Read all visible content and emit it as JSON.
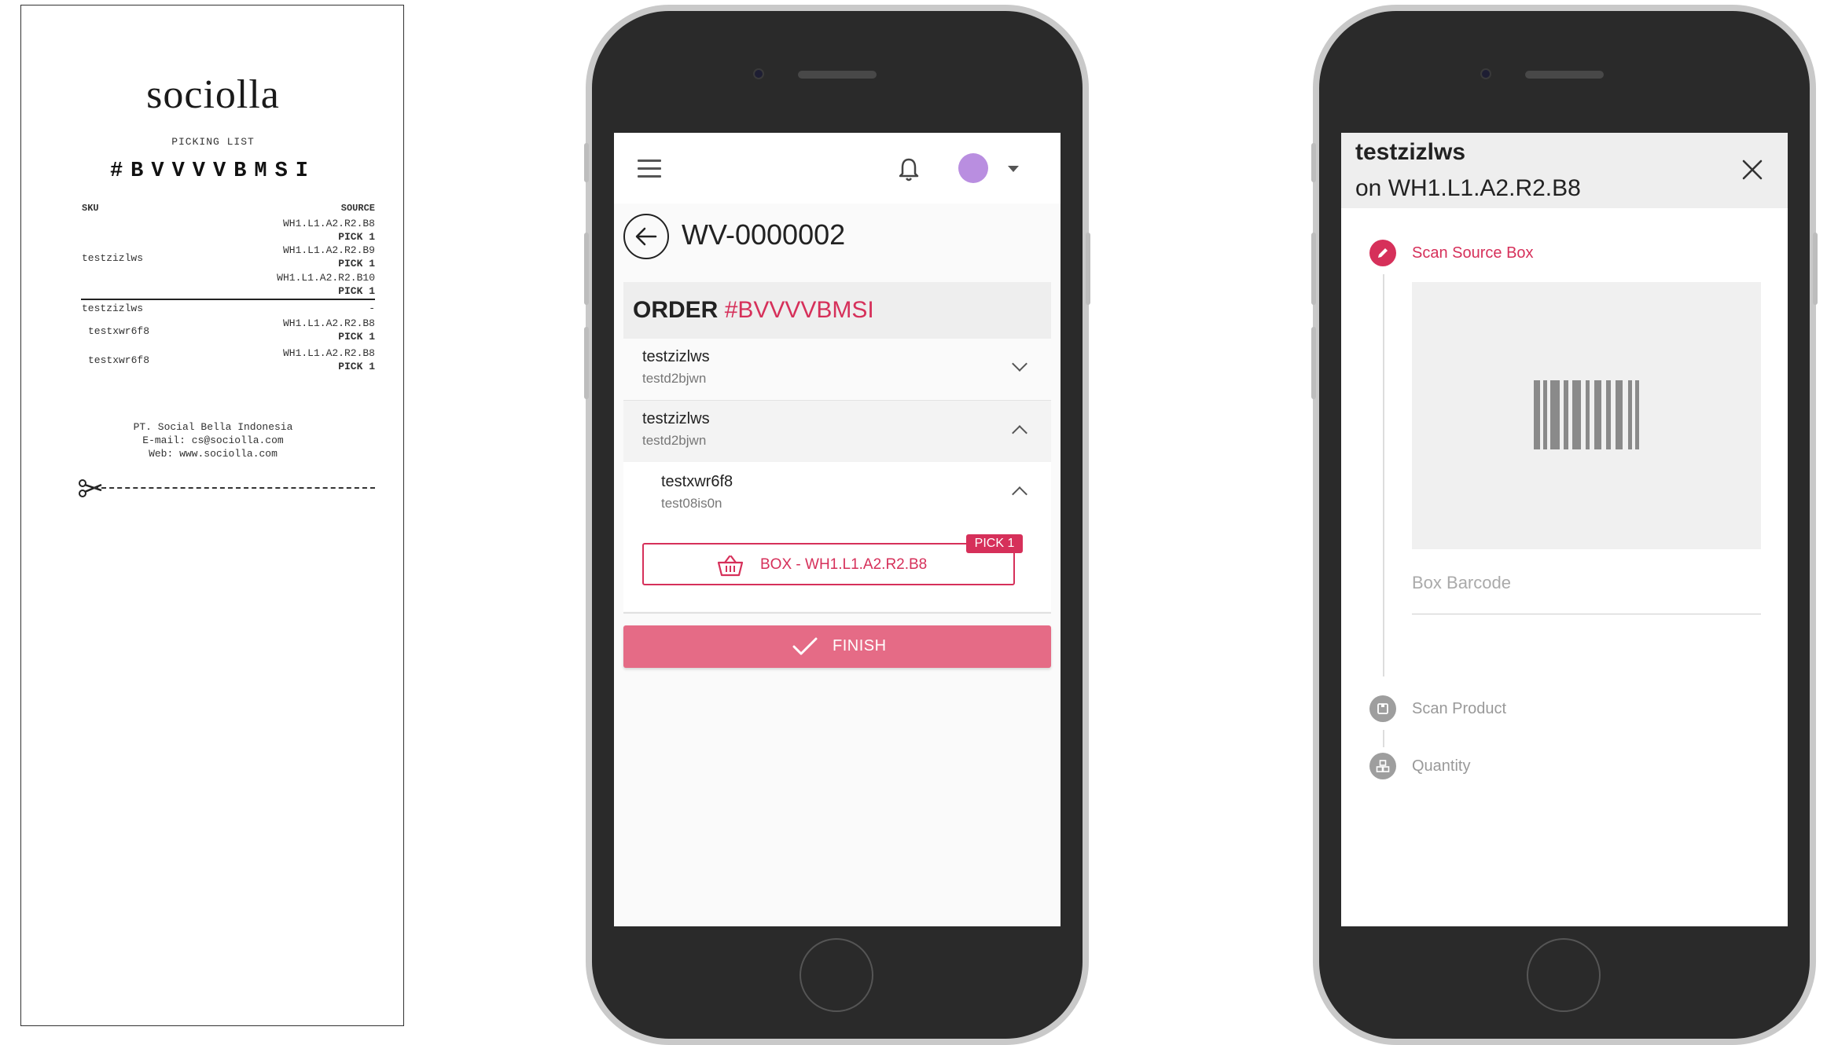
{
  "receipt": {
    "brand": "sociolla",
    "subtitle": "PICKING LIST",
    "order_number": "#BVVVVBMSI",
    "columns": {
      "sku": "SKU",
      "source": "SOURCE"
    },
    "group1": {
      "sku": "testzizlws",
      "sources": [
        {
          "location": "WH1.L1.A2.R2.B8",
          "pick": "PICK 1"
        },
        {
          "location": "WH1.L1.A2.R2.B9",
          "pick": "PICK 1"
        },
        {
          "location": "WH1.L1.A2.R2.B10",
          "pick": "PICK 1"
        }
      ]
    },
    "group2": {
      "sku": "testzizlws",
      "dash": "-",
      "children": [
        {
          "sku": "testxwr6f8",
          "location": "WH1.L1.A2.R2.B8",
          "pick": "PICK 1"
        },
        {
          "sku": "testxwr6f8",
          "location": "WH1.L1.A2.R2.B8",
          "pick": "PICK 1"
        }
      ]
    },
    "footer": {
      "company": "PT. Social Bella Indonesia",
      "email": "E-mail: cs@sociolla.com",
      "web": "Web: www.sociolla.com"
    }
  },
  "phone1": {
    "title": "WV-0000002",
    "order_label": "ORDER",
    "order_number": "#BVVVVBMSI",
    "items": [
      {
        "name": "testzizlws",
        "code": "testd2bjwn",
        "expanded": false
      },
      {
        "name": "testzizlws",
        "code": "testd2bjwn",
        "expanded": true
      },
      {
        "name": "testxwr6f8",
        "code": "test08is0n",
        "expanded": true
      }
    ],
    "box_button": {
      "label": "BOX - WH1.L1.A2.R2.B8",
      "badge": "PICK 1"
    },
    "finish_label": "FINISH",
    "colors": {
      "accent": "#d6305a",
      "finish": "#e56b86",
      "avatar": "#b98ee0"
    },
    "icons": [
      "menu-icon",
      "bell-icon",
      "avatar",
      "back-arrow-icon",
      "chevron-down-icon",
      "chevron-up-icon",
      "basket-icon",
      "check-icon"
    ]
  },
  "phone2": {
    "header_title": "testzizlws",
    "header_subtitle": "on WH1.L1.A2.R2.B8",
    "steps": [
      {
        "label": "Scan Source Box",
        "state": "active",
        "icon": "pencil-icon"
      },
      {
        "label": "Scan Product",
        "state": "idle",
        "icon": "box-icon"
      },
      {
        "label": "Quantity",
        "state": "idle",
        "icon": "stack-icon"
      }
    ],
    "field_placeholder": "Box Barcode",
    "icons": [
      "close-icon",
      "barcode-icon"
    ]
  }
}
